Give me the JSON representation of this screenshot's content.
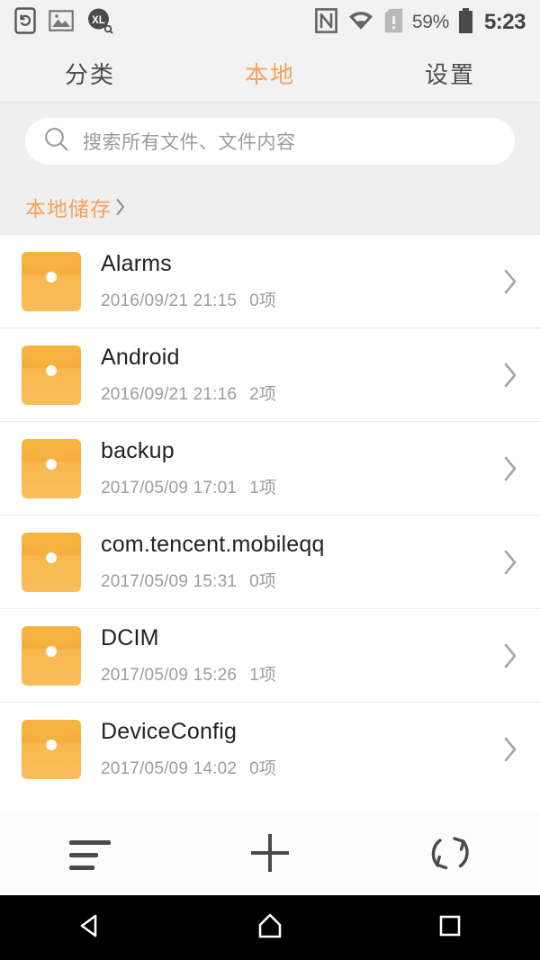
{
  "statusbar": {
    "left_icons": [
      {
        "name": "screen-rotate-icon"
      },
      {
        "name": "screenshot-image-icon"
      },
      {
        "name": "xunlei-xl-app-icon",
        "label": "XL"
      }
    ],
    "right_icons": [
      {
        "name": "nfc-icon"
      },
      {
        "name": "wifi-icon"
      },
      {
        "name": "sim-card-alert-icon"
      }
    ],
    "battery_percent": "59%",
    "clock": "5:23"
  },
  "tabs": [
    {
      "label": "分类",
      "active": false
    },
    {
      "label": "本地",
      "active": true
    },
    {
      "label": "设置",
      "active": false
    }
  ],
  "search": {
    "placeholder": "搜索所有文件、文件内容",
    "value": ""
  },
  "breadcrumb": {
    "label": "本地储存"
  },
  "files": [
    {
      "name": "Alarms",
      "date": "2016/09/21 21:15",
      "count": "0项"
    },
    {
      "name": "Android",
      "date": "2016/09/21 21:16",
      "count": "2项"
    },
    {
      "name": "backup",
      "date": "2017/05/09 17:01",
      "count": "1项"
    },
    {
      "name": "com.tencent.mobileqq",
      "date": "2017/05/09 15:31",
      "count": "0项"
    },
    {
      "name": "DCIM",
      "date": "2017/05/09 15:26",
      "count": "1项"
    },
    {
      "name": "DeviceConfig",
      "date": "2017/05/09 14:02",
      "count": "0项"
    }
  ],
  "toolbar": [
    {
      "name": "sort-list-icon"
    },
    {
      "name": "add-plus-icon"
    },
    {
      "name": "refresh-sync-icon"
    }
  ],
  "navbar": [
    {
      "name": "android-back-icon"
    },
    {
      "name": "android-home-icon"
    },
    {
      "name": "android-recents-icon"
    }
  ],
  "colors": {
    "accent_orange": "#f5a15d",
    "folder_orange": "#f6b33f",
    "header_gray": "#efefef",
    "divider": "#ededed",
    "text_primary": "#222222",
    "text_secondary": "#9d9d9d"
  }
}
